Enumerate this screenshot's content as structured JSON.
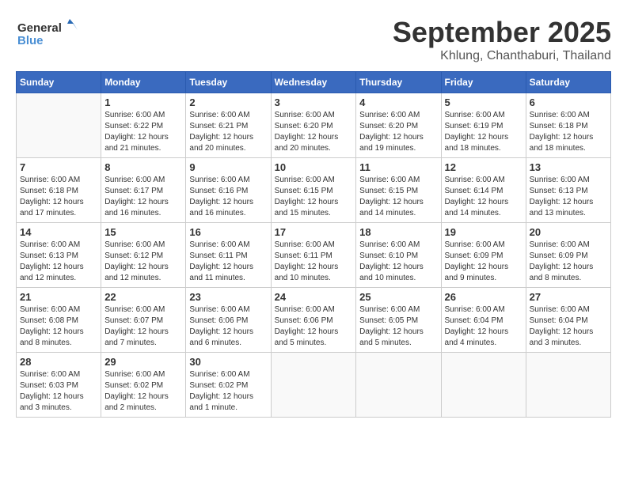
{
  "header": {
    "logo_general": "General",
    "logo_blue": "Blue",
    "month_title": "September 2025",
    "location": "Khlung, Chanthaburi, Thailand"
  },
  "weekdays": [
    "Sunday",
    "Monday",
    "Tuesday",
    "Wednesday",
    "Thursday",
    "Friday",
    "Saturday"
  ],
  "weeks": [
    [
      {
        "day": "",
        "sunrise": "",
        "sunset": "",
        "daylight": ""
      },
      {
        "day": "1",
        "sunrise": "Sunrise: 6:00 AM",
        "sunset": "Sunset: 6:22 PM",
        "daylight": "Daylight: 12 hours and 21 minutes."
      },
      {
        "day": "2",
        "sunrise": "Sunrise: 6:00 AM",
        "sunset": "Sunset: 6:21 PM",
        "daylight": "Daylight: 12 hours and 20 minutes."
      },
      {
        "day": "3",
        "sunrise": "Sunrise: 6:00 AM",
        "sunset": "Sunset: 6:20 PM",
        "daylight": "Daylight: 12 hours and 20 minutes."
      },
      {
        "day": "4",
        "sunrise": "Sunrise: 6:00 AM",
        "sunset": "Sunset: 6:20 PM",
        "daylight": "Daylight: 12 hours and 19 minutes."
      },
      {
        "day": "5",
        "sunrise": "Sunrise: 6:00 AM",
        "sunset": "Sunset: 6:19 PM",
        "daylight": "Daylight: 12 hours and 18 minutes."
      },
      {
        "day": "6",
        "sunrise": "Sunrise: 6:00 AM",
        "sunset": "Sunset: 6:18 PM",
        "daylight": "Daylight: 12 hours and 18 minutes."
      }
    ],
    [
      {
        "day": "7",
        "sunrise": "Sunrise: 6:00 AM",
        "sunset": "Sunset: 6:18 PM",
        "daylight": "Daylight: 12 hours and 17 minutes."
      },
      {
        "day": "8",
        "sunrise": "Sunrise: 6:00 AM",
        "sunset": "Sunset: 6:17 PM",
        "daylight": "Daylight: 12 hours and 16 minutes."
      },
      {
        "day": "9",
        "sunrise": "Sunrise: 6:00 AM",
        "sunset": "Sunset: 6:16 PM",
        "daylight": "Daylight: 12 hours and 16 minutes."
      },
      {
        "day": "10",
        "sunrise": "Sunrise: 6:00 AM",
        "sunset": "Sunset: 6:15 PM",
        "daylight": "Daylight: 12 hours and 15 minutes."
      },
      {
        "day": "11",
        "sunrise": "Sunrise: 6:00 AM",
        "sunset": "Sunset: 6:15 PM",
        "daylight": "Daylight: 12 hours and 14 minutes."
      },
      {
        "day": "12",
        "sunrise": "Sunrise: 6:00 AM",
        "sunset": "Sunset: 6:14 PM",
        "daylight": "Daylight: 12 hours and 14 minutes."
      },
      {
        "day": "13",
        "sunrise": "Sunrise: 6:00 AM",
        "sunset": "Sunset: 6:13 PM",
        "daylight": "Daylight: 12 hours and 13 minutes."
      }
    ],
    [
      {
        "day": "14",
        "sunrise": "Sunrise: 6:00 AM",
        "sunset": "Sunset: 6:13 PM",
        "daylight": "Daylight: 12 hours and 12 minutes."
      },
      {
        "day": "15",
        "sunrise": "Sunrise: 6:00 AM",
        "sunset": "Sunset: 6:12 PM",
        "daylight": "Daylight: 12 hours and 12 minutes."
      },
      {
        "day": "16",
        "sunrise": "Sunrise: 6:00 AM",
        "sunset": "Sunset: 6:11 PM",
        "daylight": "Daylight: 12 hours and 11 minutes."
      },
      {
        "day": "17",
        "sunrise": "Sunrise: 6:00 AM",
        "sunset": "Sunset: 6:11 PM",
        "daylight": "Daylight: 12 hours and 10 minutes."
      },
      {
        "day": "18",
        "sunrise": "Sunrise: 6:00 AM",
        "sunset": "Sunset: 6:10 PM",
        "daylight": "Daylight: 12 hours and 10 minutes."
      },
      {
        "day": "19",
        "sunrise": "Sunrise: 6:00 AM",
        "sunset": "Sunset: 6:09 PM",
        "daylight": "Daylight: 12 hours and 9 minutes."
      },
      {
        "day": "20",
        "sunrise": "Sunrise: 6:00 AM",
        "sunset": "Sunset: 6:09 PM",
        "daylight": "Daylight: 12 hours and 8 minutes."
      }
    ],
    [
      {
        "day": "21",
        "sunrise": "Sunrise: 6:00 AM",
        "sunset": "Sunset: 6:08 PM",
        "daylight": "Daylight: 12 hours and 8 minutes."
      },
      {
        "day": "22",
        "sunrise": "Sunrise: 6:00 AM",
        "sunset": "Sunset: 6:07 PM",
        "daylight": "Daylight: 12 hours and 7 minutes."
      },
      {
        "day": "23",
        "sunrise": "Sunrise: 6:00 AM",
        "sunset": "Sunset: 6:06 PM",
        "daylight": "Daylight: 12 hours and 6 minutes."
      },
      {
        "day": "24",
        "sunrise": "Sunrise: 6:00 AM",
        "sunset": "Sunset: 6:06 PM",
        "daylight": "Daylight: 12 hours and 5 minutes."
      },
      {
        "day": "25",
        "sunrise": "Sunrise: 6:00 AM",
        "sunset": "Sunset: 6:05 PM",
        "daylight": "Daylight: 12 hours and 5 minutes."
      },
      {
        "day": "26",
        "sunrise": "Sunrise: 6:00 AM",
        "sunset": "Sunset: 6:04 PM",
        "daylight": "Daylight: 12 hours and 4 minutes."
      },
      {
        "day": "27",
        "sunrise": "Sunrise: 6:00 AM",
        "sunset": "Sunset: 6:04 PM",
        "daylight": "Daylight: 12 hours and 3 minutes."
      }
    ],
    [
      {
        "day": "28",
        "sunrise": "Sunrise: 6:00 AM",
        "sunset": "Sunset: 6:03 PM",
        "daylight": "Daylight: 12 hours and 3 minutes."
      },
      {
        "day": "29",
        "sunrise": "Sunrise: 6:00 AM",
        "sunset": "Sunset: 6:02 PM",
        "daylight": "Daylight: 12 hours and 2 minutes."
      },
      {
        "day": "30",
        "sunrise": "Sunrise: 6:00 AM",
        "sunset": "Sunset: 6:02 PM",
        "daylight": "Daylight: 12 hours and 1 minute."
      },
      {
        "day": "",
        "sunrise": "",
        "sunset": "",
        "daylight": ""
      },
      {
        "day": "",
        "sunrise": "",
        "sunset": "",
        "daylight": ""
      },
      {
        "day": "",
        "sunrise": "",
        "sunset": "",
        "daylight": ""
      },
      {
        "day": "",
        "sunrise": "",
        "sunset": "",
        "daylight": ""
      }
    ]
  ]
}
